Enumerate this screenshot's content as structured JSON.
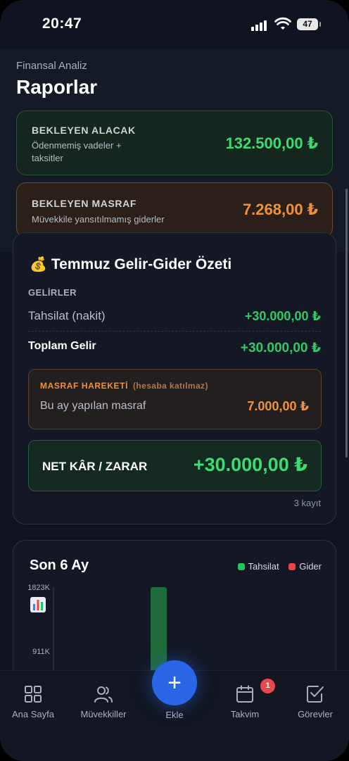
{
  "status_bar": {
    "time": "20:47",
    "battery": "47"
  },
  "header": {
    "eyebrow": "Finansal Analiz",
    "title": "Raporlar"
  },
  "cards": {
    "receivable": {
      "label": "BEKLEYEN ALACAK",
      "subtitle": "Ödenmemiş vadeler + taksitler",
      "amount": "132.500,00 ₺"
    },
    "expense": {
      "label": "BEKLEYEN MASRAF",
      "subtitle": "Müvekkile yansıtılmamış giderler",
      "amount": "7.268,00 ₺"
    }
  },
  "summary": {
    "title": "Temmuz Gelir-Gider Özeti",
    "income_section": "GELİRLER",
    "income_row": {
      "label": "Tahsilat (nakit)",
      "amount": "+30.000,00 ₺"
    },
    "total_row": {
      "label": "Toplam Gelir",
      "amount": "+30.000,00 ₺"
    },
    "expense_movement": {
      "heading": "MASRAF HAREKETİ",
      "note": "(hesaba katılmaz)",
      "label": "Bu ay yapılan masraf",
      "amount": "7.000,00 ₺"
    },
    "net": {
      "label": "NET KÂR / ZARAR",
      "amount": "+30.000,00 ₺"
    },
    "record_count": "3 kayıt"
  },
  "chart_section": {
    "title": "Son 6 Ay",
    "legend": [
      {
        "name": "Tahsilat",
        "color": "#22c55e"
      },
      {
        "name": "Gider",
        "color": "#ef4444"
      }
    ]
  },
  "chart_data": {
    "type": "bar",
    "title": "Son 6 Ay",
    "ytick_labels": [
      "1823K",
      "911K"
    ],
    "series": [
      {
        "name": "Tahsilat",
        "color": "#22c55e",
        "visible_values": [
          1823
        ]
      },
      {
        "name": "Gider",
        "color": "#ef4444",
        "visible_values": []
      }
    ],
    "ylim": [
      0,
      1823
    ]
  },
  "nav": {
    "items": [
      {
        "label": "Ana Sayfa",
        "icon": "grid-icon"
      },
      {
        "label": "Müvekkiller",
        "icon": "users-icon"
      },
      {
        "label": "Ekle",
        "icon": "plus-icon"
      },
      {
        "label": "Takvim",
        "icon": "calendar-icon",
        "badge": "1"
      },
      {
        "label": "Görevler",
        "icon": "checkbox-icon"
      }
    ]
  }
}
